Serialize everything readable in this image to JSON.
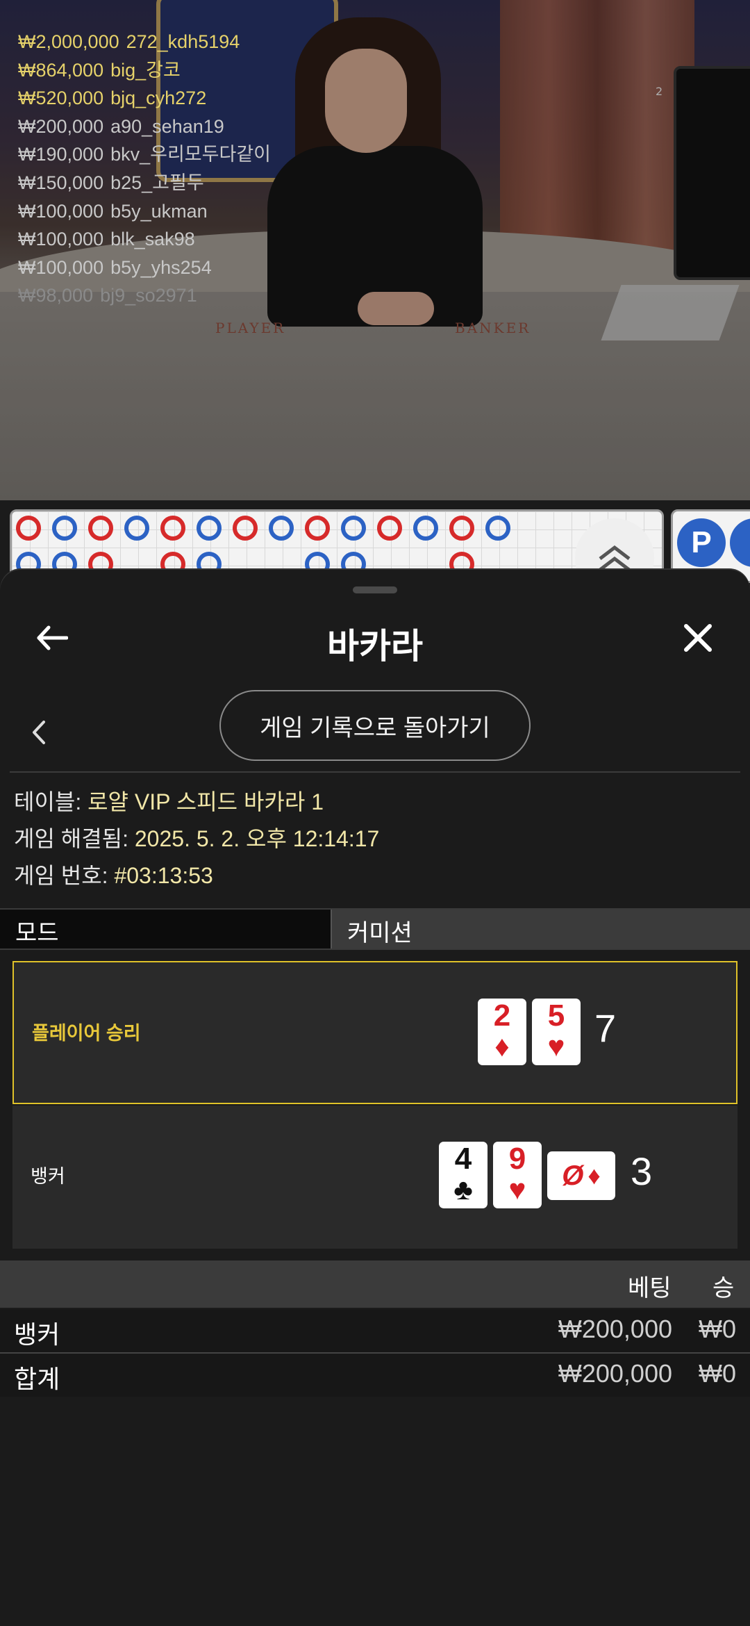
{
  "video": {
    "winners": [
      {
        "amount": "₩2,000,000",
        "user": "272_kdh5194",
        "color": "#e6d26a"
      },
      {
        "amount": "₩864,000",
        "user": "big_강코",
        "color": "#e6d26a"
      },
      {
        "amount": "₩520,000",
        "user": "bjq_cyh272",
        "color": "#e6d26a"
      },
      {
        "amount": "₩200,000",
        "user": "a90_sehan19",
        "color": "#c8c8c8"
      },
      {
        "amount": "₩190,000",
        "user": "bkv_우리모두다같이",
        "color": "#c8c8c8"
      },
      {
        "amount": "₩150,000",
        "user": "b25_고필두",
        "color": "#c8c8c8"
      },
      {
        "amount": "₩100,000",
        "user": "b5y_ukman",
        "color": "#c8c8c8"
      },
      {
        "amount": "₩100,000",
        "user": "blk_sak98",
        "color": "#c8c8c8"
      },
      {
        "amount": "₩100,000",
        "user": "b5y_yhs254",
        "color": "#c8c8c8"
      },
      {
        "amount": "₩98,000",
        "user": "bj9_so2971",
        "color": "#8a8a8a"
      }
    ],
    "counter": "2",
    "table_left": "PLAYER",
    "table_right": "BANKER"
  },
  "sheet": {
    "title": "바카라",
    "history_button": "게임 기록으로 돌아가기",
    "info": {
      "table_label": "테이블:",
      "table_value": "로얄 VIP 스피드 바카라 1",
      "resolved_label": "게임 해결됨:",
      "resolved_value": "2025. 5. 2. 오후 12:14:17",
      "number_label": "게임 번호:",
      "number_value": "#03:13:53"
    },
    "mode": {
      "left": "모드",
      "right": "커미션"
    },
    "player": {
      "label": "플레이어 승리",
      "score": "7",
      "cards": [
        {
          "rank": "2",
          "suit": "♦",
          "color": "red"
        },
        {
          "rank": "5",
          "suit": "♥",
          "color": "red"
        }
      ]
    },
    "banker": {
      "label": "뱅커",
      "score": "3",
      "cards": [
        {
          "rank": "4",
          "suit": "♣",
          "color": "black"
        },
        {
          "rank": "9",
          "suit": "♥",
          "color": "red"
        },
        {
          "rank": "Ø",
          "suit": "♦",
          "color": "red",
          "sideways": true
        }
      ]
    },
    "bets": {
      "headers": {
        "bet": "베팅",
        "win": "승"
      },
      "rows": [
        {
          "name": "뱅커",
          "bet": "₩200,000",
          "win": "₩0"
        },
        {
          "name": "합계",
          "bet": "₩200,000",
          "win": "₩0"
        }
      ]
    }
  },
  "colors": {
    "player_blue": "#2c62c4",
    "banker_red": "#d62a2a",
    "win_highlight": "#e0c229"
  }
}
